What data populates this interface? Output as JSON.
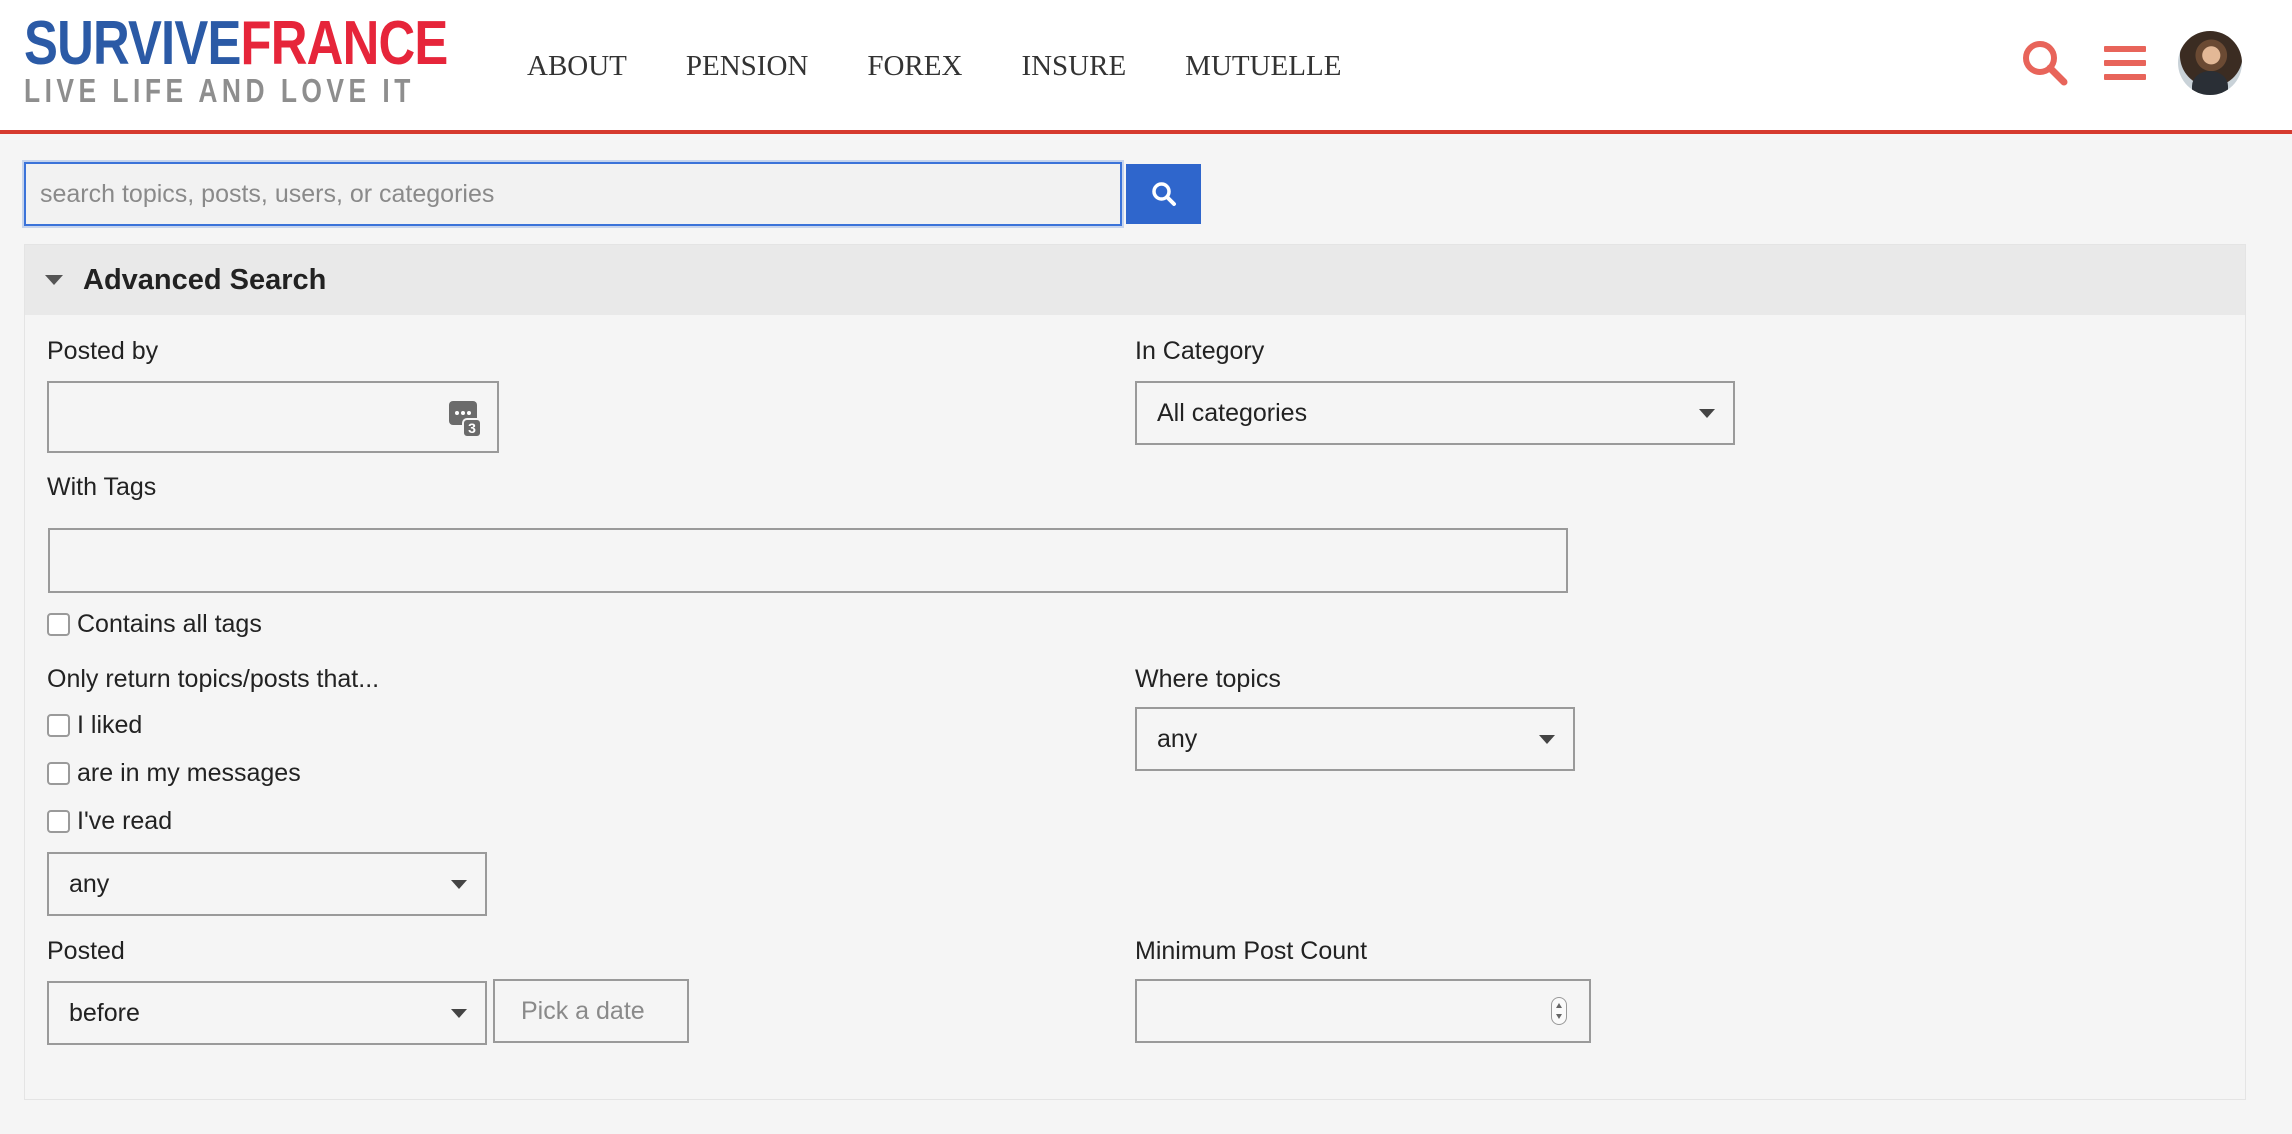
{
  "brand": {
    "name_part1": "SURVIVE",
    "name_part2": "FRANCE",
    "tagline": "LIVE LIFE AND LOVE IT",
    "colors": {
      "blue": "#2b5aa6",
      "red": "#e6253a",
      "accent": "#d63b2f"
    }
  },
  "nav": {
    "items": [
      {
        "label": "ABOUT"
      },
      {
        "label": "PENSION"
      },
      {
        "label": "FOREX"
      },
      {
        "label": "INSURE"
      },
      {
        "label": "MUTUELLE"
      }
    ]
  },
  "header_icons": {
    "search": "search-icon",
    "menu": "hamburger-menu-icon",
    "avatar": "user-avatar"
  },
  "search": {
    "placeholder": "search topics, posts, users, or categories",
    "value": "",
    "button_icon": "search-icon",
    "button_color": "#2f66cc"
  },
  "advanced": {
    "title": "Advanced Search",
    "posted_by_label": "Posted by",
    "posted_by_badge": "3",
    "in_category_label": "In Category",
    "in_category_value": "All categories",
    "with_tags_label": "With Tags",
    "contains_all_tags_label": "Contains all tags",
    "only_return_label": "Only return topics/posts that...",
    "checks": [
      {
        "label": "I liked"
      },
      {
        "label": "are in my messages"
      },
      {
        "label": "I've read"
      }
    ],
    "only_return_select_value": "any",
    "where_topics_label": "Where topics",
    "where_topics_value": "any",
    "posted_label": "Posted",
    "posted_select_value": "before",
    "date_placeholder": "Pick a date",
    "min_post_count_label": "Minimum Post Count"
  }
}
